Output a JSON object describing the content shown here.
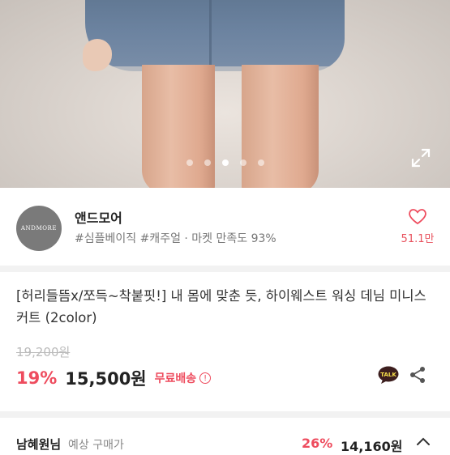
{
  "gallery": {
    "dots": 5,
    "active_index": 2
  },
  "seller": {
    "logo_text": "ANDMORE",
    "name": "앤드모어",
    "tags": "#심플베이직 #캐주얼 · 마켓 만족도 93%",
    "likes": "51.1만"
  },
  "product": {
    "title": "[허리들뜸x/쪼득~착붙핏!] 내 몸에 맞춘 듯, 하이웨스트 워싱 데님 미니스커트 (2color)",
    "original_price": "19,200원",
    "discount": "19%",
    "price": "15,500원",
    "shipping": "무료배송",
    "info_icon_text": "!"
  },
  "bottom": {
    "name": "남혜원님",
    "label": "예상 구매가",
    "discount": "26%",
    "price": "14,160원"
  },
  "colors": {
    "accent": "#ee4c5e",
    "kakao": "#3c1e1e"
  }
}
